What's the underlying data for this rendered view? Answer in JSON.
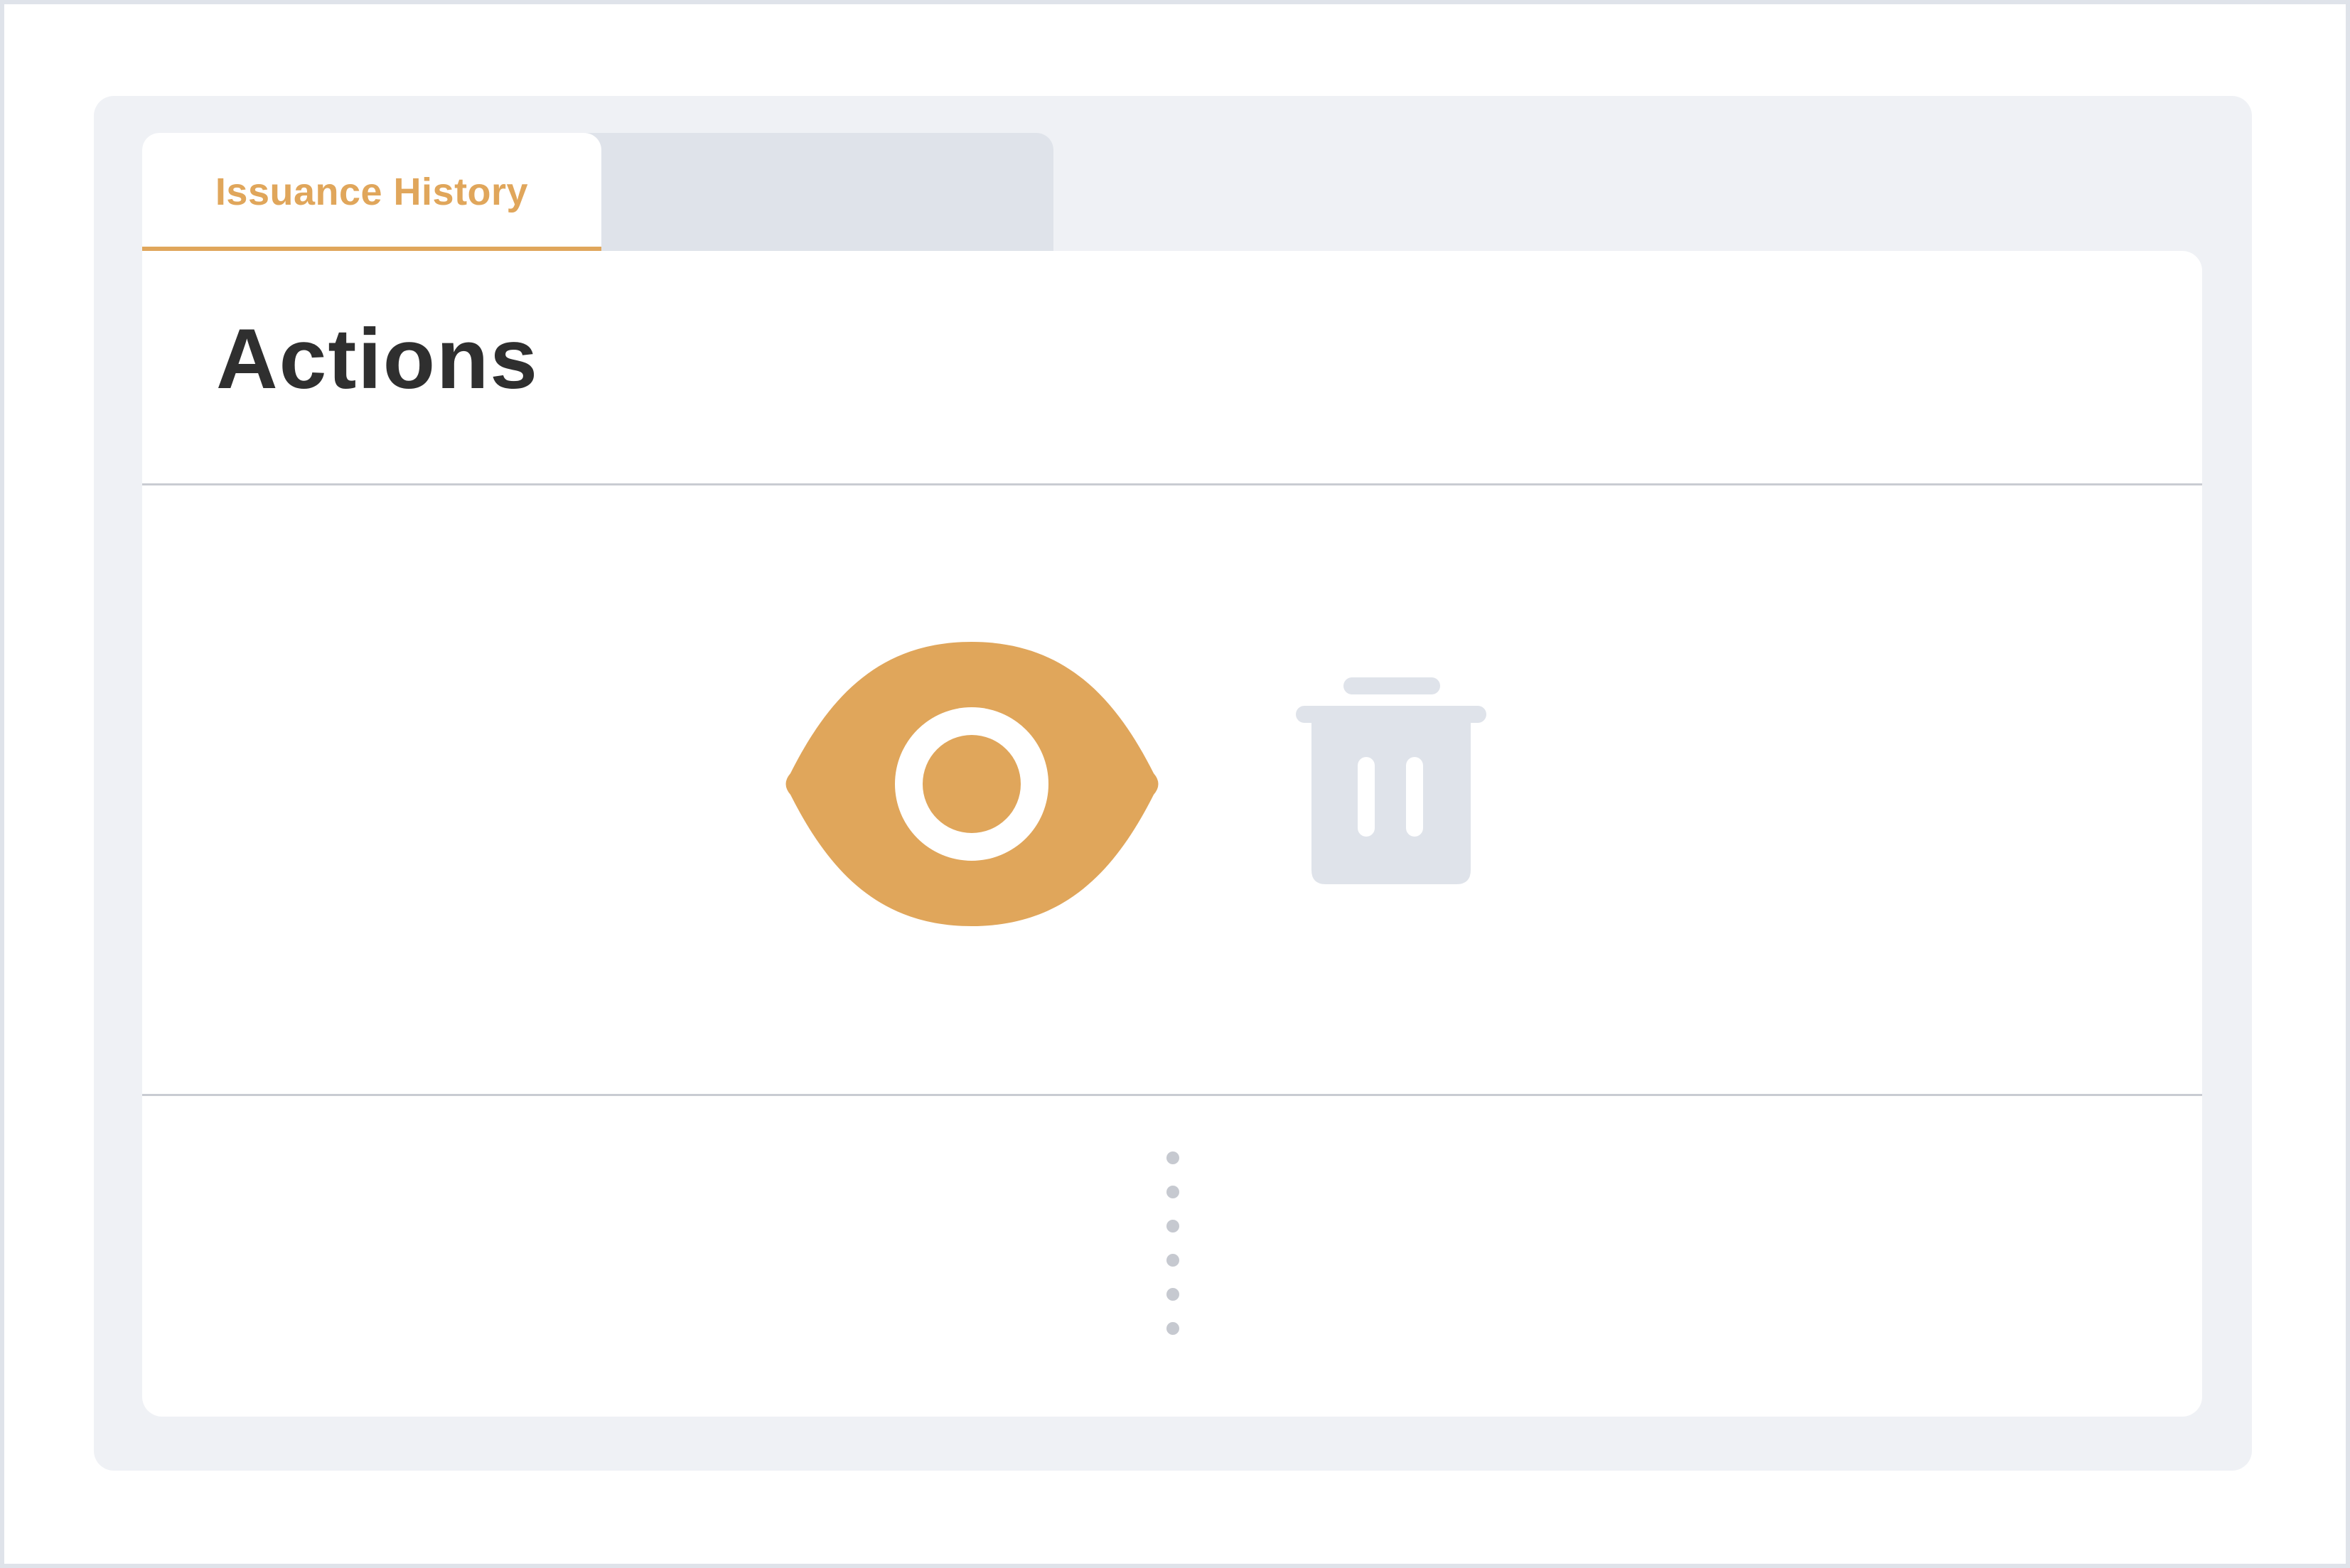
{
  "tabs": [
    {
      "label": "Issuance History",
      "active": true
    },
    {
      "label": "",
      "active": false
    }
  ],
  "card": {
    "title": "Actions"
  },
  "actions": [
    {
      "name": "view",
      "icon": "eye-icon",
      "color": "#e0a65b"
    },
    {
      "name": "delete",
      "icon": "trash-icon",
      "color": "#dfe3ea"
    }
  ],
  "colors": {
    "accent": "#e0a65b",
    "muted": "#dfe3ea",
    "panel": "#eff1f5",
    "title": "#2f2f2f"
  }
}
